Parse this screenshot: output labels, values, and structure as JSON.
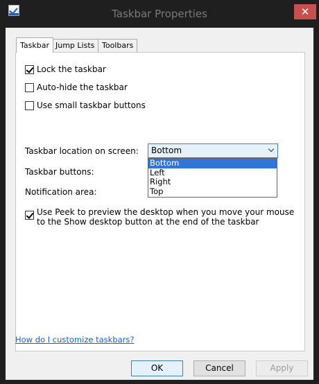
{
  "window": {
    "title": "Taskbar Properties",
    "close_glyph": "✕"
  },
  "tabs": [
    {
      "label": "Taskbar",
      "active": true
    },
    {
      "label": "Jump Lists",
      "active": false
    },
    {
      "label": "Toolbars",
      "active": false
    }
  ],
  "options": {
    "lock": {
      "label": "Lock the taskbar",
      "checked": true
    },
    "autohide": {
      "label": "Auto-hide the taskbar",
      "checked": false
    },
    "small_buttons": {
      "label": "Use small taskbar buttons",
      "checked": false
    }
  },
  "location": {
    "label": "Taskbar location on screen:",
    "value": "Bottom",
    "items": [
      "Bottom",
      "Left",
      "Right",
      "Top"
    ]
  },
  "buttons_setting": {
    "label": "Taskbar buttons:"
  },
  "notification": {
    "label": "Notification area:"
  },
  "peek": {
    "label": "Use Peek to preview the desktop when you move your mouse to the Show desktop button at the end of the taskbar",
    "checked": true
  },
  "help_link": "How do I customize taskbars?",
  "footer": {
    "ok": "OK",
    "cancel": "Cancel",
    "apply": "Apply"
  }
}
